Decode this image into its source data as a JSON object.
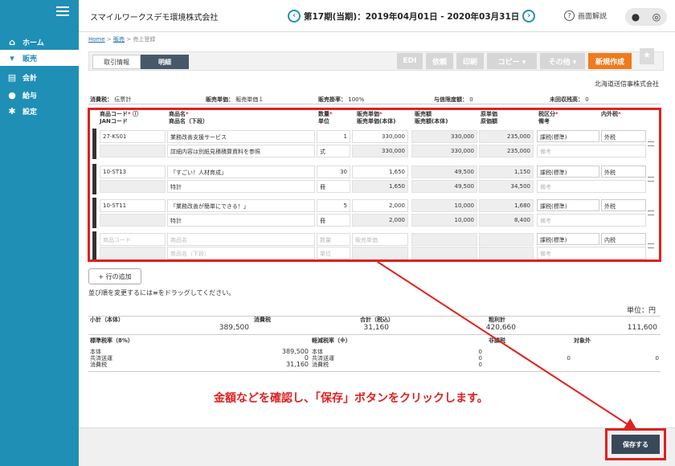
{
  "sidebar": {
    "items": [
      {
        "label": "ホーム",
        "icon": "home-icon"
      },
      {
        "label": "販売",
        "icon": "cart-icon"
      },
      {
        "label": "会計",
        "icon": "ledger-icon"
      },
      {
        "label": "給与",
        "icon": "wallet-icon"
      },
      {
        "label": "設定",
        "icon": "gear-icon"
      }
    ]
  },
  "header": {
    "company": "スマイルワークスデモ環境株式会社",
    "period": "第17期(当期)：2019年04月01日 - 2020年03月31日",
    "help": "画面解説"
  },
  "breadcrumb": {
    "home": "Home",
    "sep1": ">",
    "sales": "販売",
    "sep2": ">",
    "current": "売上登録"
  },
  "tabs": {
    "t1": "取引情報",
    "t2": "明細"
  },
  "toolbar": {
    "edi": "EDI",
    "ref": "依頼",
    "print": "印刷",
    "copy": "コピー ▾",
    "other": "その他 ▾",
    "new": "新規作成"
  },
  "client": "北海道送信事株式会社",
  "info": {
    "tax_calc_label": "消費税：",
    "tax_calc_value": "伝票計",
    "price_label": "販売単価：",
    "price_value": "販売単価１",
    "rate_label": "販売掛率：",
    "rate_value": "100%",
    "credit_label": "与信限度額：",
    "credit_value": "0",
    "unpaid_label": "未回収残高：",
    "unpaid_value": "0"
  },
  "columns": {
    "code": "商品コード",
    "code2": "JANコード",
    "name": "商品名",
    "name2": "商品名（下段）",
    "qty": "数量",
    "unit": "単位",
    "price": "販売単価",
    "price2": "販売単価(本体)",
    "amount": "販売額",
    "amount2": "販売額(本体)",
    "cost": "原単価",
    "cost2": "原価額",
    "tax": "税区分",
    "tax2": "備考",
    "incl": "内外税",
    "req": "*"
  },
  "rows": [
    {
      "code": "27-KS01",
      "name": "業務改善支援サービス",
      "name2": "詳細内容は別紙見積積算資料を参照",
      "qty": "1",
      "unit": "式",
      "price": "330,000",
      "price2": "330,000",
      "amount": "330,000",
      "amount2": "330,000",
      "cost": "235,000",
      "cost2": "235,000",
      "tax": "課税(標準)",
      "incl": "外税",
      "memo": "備考"
    },
    {
      "code": "10-ST13",
      "name": "「すごい！人材育成」",
      "name2": "特計",
      "qty": "30",
      "unit": "冊",
      "price": "1,650",
      "price2": "1,650",
      "amount": "49,500",
      "amount2": "49,500",
      "cost": "1,150",
      "cost2": "34,500",
      "tax": "課税(標準)",
      "incl": "外税",
      "memo": "備考"
    },
    {
      "code": "10-ST11",
      "name": "「業務改善が簡単にできる！」",
      "name2": "特計",
      "qty": "5",
      "unit": "冊",
      "price": "2,000",
      "price2": "2,000",
      "amount": "10,000",
      "amount2": "10,000",
      "cost": "1,680",
      "cost2": "8,400",
      "tax": "課税(標準)",
      "incl": "外税",
      "memo": "備考"
    }
  ],
  "blank_row": {
    "code": "商品コード",
    "name": "商品名",
    "name2": "商品名（下段）",
    "qty": "数量",
    "unit": "単位",
    "price": "販売単価",
    "tax": "課税(標準)",
    "incl": "内税",
    "memo": "備考"
  },
  "add_row": "+ 行の追加",
  "drag_note": "並び順を変更するには≡をドラッグしてください。",
  "unit_label": "単位：円",
  "totals": {
    "subtotal_label": "小計（本体）",
    "subtotal": "389,500",
    "tax_label": "消費税",
    "tax": "31,160",
    "total_label": "合計（税込）",
    "total": "420,660",
    "profit_label": "粗利計",
    "profit": "111,600"
  },
  "tax_breakdown": {
    "standard_label": "標準税率（8%）",
    "reduced_label": "軽減税率（※）",
    "exempt_label": "非課税",
    "outside_label": "対象外",
    "body": "本体",
    "transport": "共済送運",
    "ctax": "消費税",
    "std_body": "389,500",
    "std_transport": "0",
    "std_ctax": "31,160",
    "red_body": "0",
    "red_transport": "0",
    "red_ctax": "0",
    "exempt_val": "0",
    "outside_val": "0"
  },
  "note": "金額などを確認し、「保存」ボタンをクリックします。",
  "save": "保存する",
  "colors": {
    "sidebar": "#1f8fb6",
    "accent": "#ee7b1d",
    "annotation": "#e02020",
    "dark": "#39495a"
  }
}
